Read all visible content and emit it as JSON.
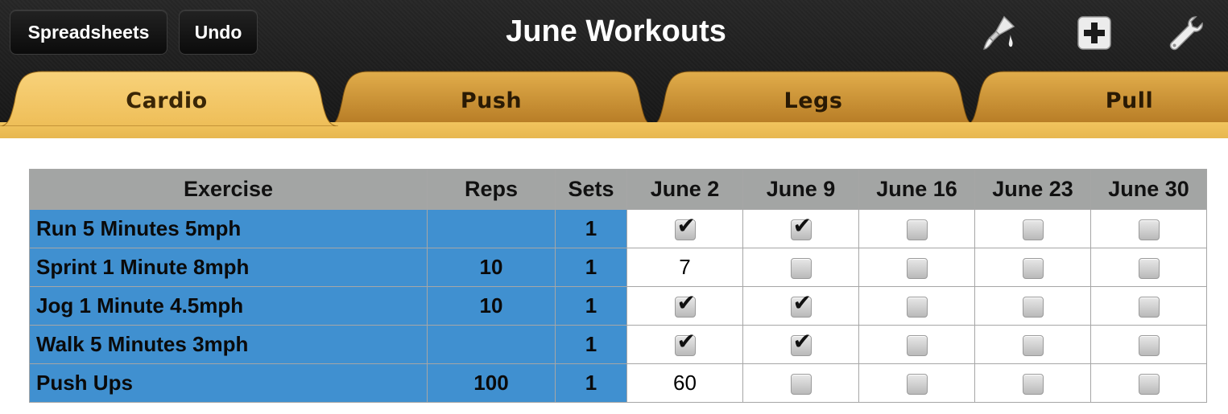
{
  "toolbar": {
    "spreadsheets_label": "Spreadsheets",
    "undo_label": "Undo",
    "title": "June Workouts",
    "icons": [
      "paintbrush-icon",
      "add-icon",
      "wrench-icon"
    ]
  },
  "tabs": [
    {
      "label": "Cardio",
      "active": true
    },
    {
      "label": "Push",
      "active": false
    },
    {
      "label": "Legs",
      "active": false
    },
    {
      "label": "Pull",
      "active": false
    }
  ],
  "colors": {
    "tab_active": "#f2c76a",
    "tab_inactive": "#c8902e",
    "header_bg": "#a3a5a4",
    "row_label_bg": "#4090d0"
  },
  "table": {
    "headers": [
      "Exercise",
      "Reps",
      "Sets",
      "June 2",
      "June 9",
      "June 16",
      "June 23",
      "June 30"
    ],
    "rows": [
      {
        "exercise": "Run 5 Minutes 5mph",
        "reps": "",
        "sets": "1",
        "cells": [
          {
            "type": "check",
            "checked": true
          },
          {
            "type": "check",
            "checked": true
          },
          {
            "type": "check",
            "checked": false
          },
          {
            "type": "check",
            "checked": false
          },
          {
            "type": "check",
            "checked": false
          }
        ]
      },
      {
        "exercise": "Sprint 1 Minute 8mph",
        "reps": "10",
        "sets": "1",
        "cells": [
          {
            "type": "value",
            "value": "7"
          },
          {
            "type": "check",
            "checked": false
          },
          {
            "type": "check",
            "checked": false
          },
          {
            "type": "check",
            "checked": false
          },
          {
            "type": "check",
            "checked": false
          }
        ]
      },
      {
        "exercise": "Jog 1 Minute 4.5mph",
        "reps": "10",
        "sets": "1",
        "cells": [
          {
            "type": "check",
            "checked": true
          },
          {
            "type": "check",
            "checked": true
          },
          {
            "type": "check",
            "checked": false
          },
          {
            "type": "check",
            "checked": false
          },
          {
            "type": "check",
            "checked": false
          }
        ]
      },
      {
        "exercise": "Walk 5 Minutes 3mph",
        "reps": "",
        "sets": "1",
        "cells": [
          {
            "type": "check",
            "checked": true
          },
          {
            "type": "check",
            "checked": true
          },
          {
            "type": "check",
            "checked": false
          },
          {
            "type": "check",
            "checked": false
          },
          {
            "type": "check",
            "checked": false
          }
        ]
      },
      {
        "exercise": "Push Ups",
        "reps": "100",
        "sets": "1",
        "cells": [
          {
            "type": "value",
            "value": "60"
          },
          {
            "type": "check",
            "checked": false
          },
          {
            "type": "check",
            "checked": false
          },
          {
            "type": "check",
            "checked": false
          },
          {
            "type": "check",
            "checked": false
          }
        ]
      }
    ]
  }
}
